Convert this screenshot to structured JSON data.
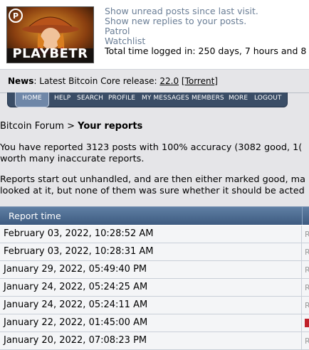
{
  "header": {
    "avatar_text": "PLAYBETR",
    "links": [
      "Show unread posts since last visit.",
      "Show new replies to your posts.",
      "Patrol",
      "Watchlist"
    ],
    "time_logged": "Total time logged in: 250 days, 7 hours and 8 mi"
  },
  "news": {
    "label": "News",
    "text": ": Latest Bitcoin Core release: ",
    "version": "22.0",
    "torrent": "Torrent"
  },
  "menu": [
    "HOME",
    "HELP",
    "SEARCH",
    "PROFILE",
    "MY MESSAGES",
    "MEMBERS",
    "MORE",
    "LOGOUT"
  ],
  "breadcrumb": {
    "forum": "Bitcoin Forum",
    "sep": " > ",
    "current": "Your reports"
  },
  "paragraphs": {
    "p1_line1": "You have reported 3123 posts with 100% accuracy (3082 good, 1(",
    "p1_line2": "worth many inaccurate reports.",
    "p2_line1": "Reports start out unhandled, and are then either marked good, ma",
    "p2_line2": "looked at it, but none of them was sure whether it should be acted"
  },
  "table": {
    "header": "Report time",
    "rows": [
      "February 03, 2022, 10:28:52 AM",
      "February 03, 2022, 10:28:31 AM",
      "January 29, 2022, 05:49:40 PM",
      "January 24, 2022, 05:24:25 AM",
      "January 24, 2022, 05:24:11 AM",
      "January 22, 2022, 01:45:00 AM",
      "January 20, 2022, 07:08:23 PM"
    ]
  }
}
